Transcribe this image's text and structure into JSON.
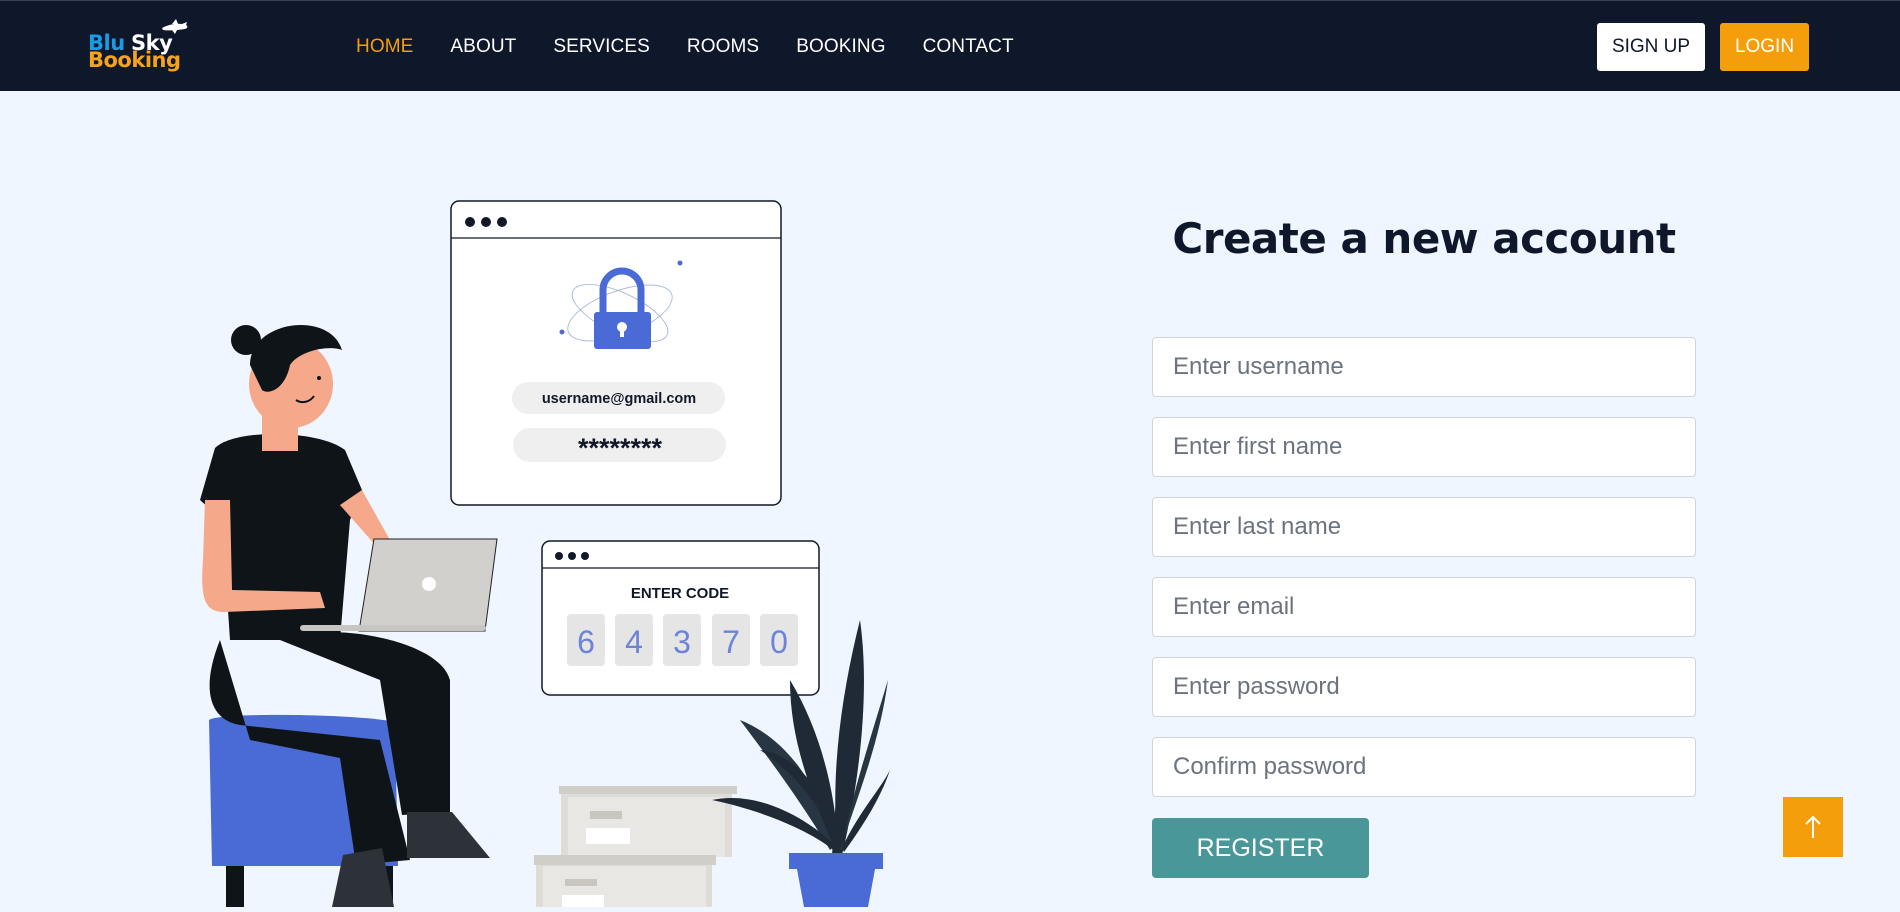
{
  "brand": {
    "logo_word1": "Blu",
    "logo_word2": "Sky",
    "logo_word3": "Booking",
    "colors": {
      "nav_bg": "#0f172a",
      "accent": "#f59e0b",
      "page_bg": "#eff6ff",
      "register": "#4a9799"
    }
  },
  "nav": {
    "links": [
      {
        "label": "HOME",
        "active": true
      },
      {
        "label": "ABOUT",
        "active": false
      },
      {
        "label": "SERVICES",
        "active": false
      },
      {
        "label": "ROOMS",
        "active": false
      },
      {
        "label": "BOOKING",
        "active": false
      },
      {
        "label": "CONTACT",
        "active": false
      }
    ],
    "signup_label": "SIGN UP",
    "login_label": "LOGIN"
  },
  "form": {
    "title": "Create a new account",
    "fields": {
      "username": {
        "placeholder": "Enter username",
        "value": ""
      },
      "first_name": {
        "placeholder": "Enter first name",
        "value": ""
      },
      "last_name": {
        "placeholder": "Enter last name",
        "value": ""
      },
      "email": {
        "placeholder": "Enter email",
        "value": ""
      },
      "password": {
        "placeholder": "Enter password",
        "value": ""
      },
      "confirm_password": {
        "placeholder": "Confirm password",
        "value": ""
      }
    },
    "register_label": "REGISTER"
  },
  "illustration": {
    "email_text": "username@gmail.com",
    "password_text": "********",
    "code_title": "ENTER CODE",
    "code_digits": [
      "6",
      "4",
      "3",
      "7",
      "0"
    ]
  },
  "scroll_top_icon": "arrow-up-icon"
}
